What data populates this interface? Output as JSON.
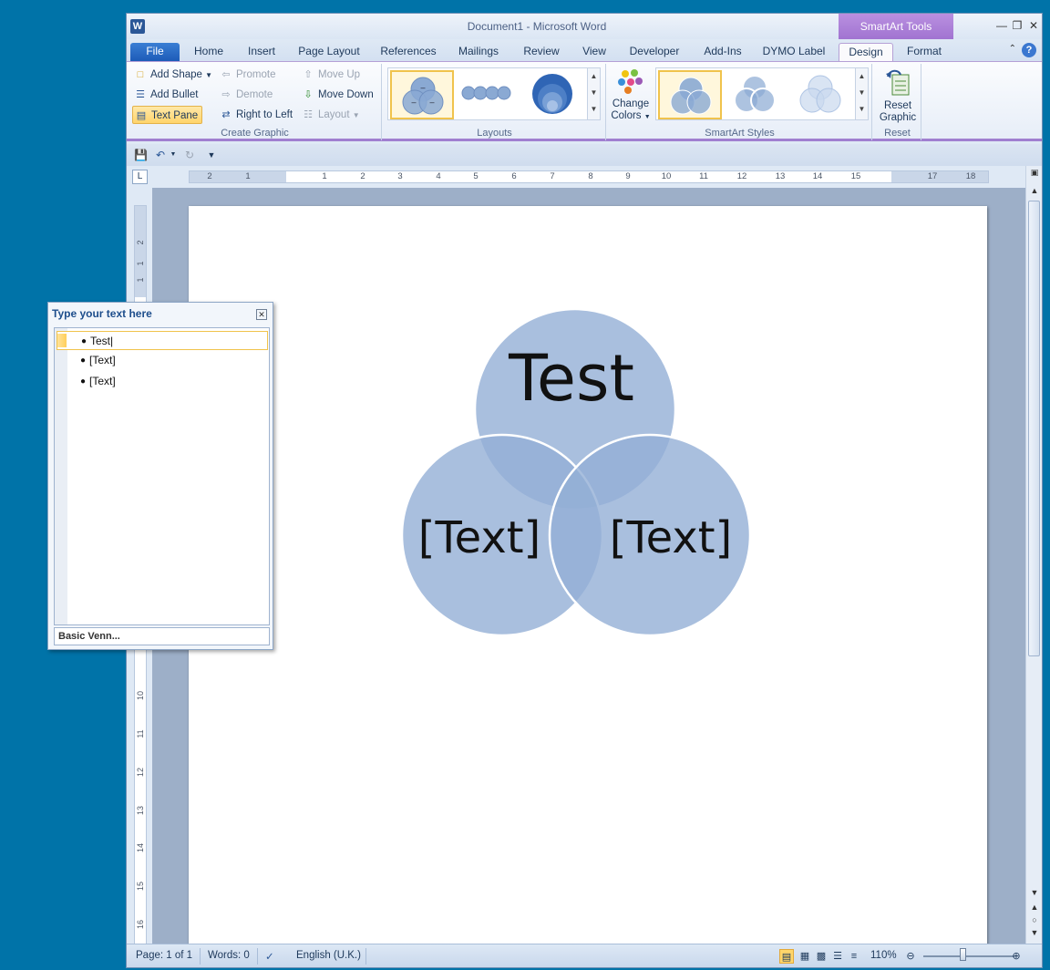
{
  "window": {
    "title": "Document1  -  Microsoft Word",
    "tools_tab": "SmartArt Tools",
    "app_icon_letter": "W"
  },
  "tabs": [
    "File",
    "Home",
    "Insert",
    "Page Layout",
    "References",
    "Mailings",
    "Review",
    "View",
    "Developer",
    "Add-Ins",
    "DYMO Label",
    "Design",
    "Format"
  ],
  "ribbon": {
    "create_graphic": {
      "label": "Create Graphic",
      "add_shape": "Add Shape",
      "add_bullet": "Add Bullet",
      "text_pane": "Text Pane",
      "promote": "Promote",
      "demote": "Demote",
      "right_to_left": "Right to Left",
      "move_up": "Move Up",
      "move_down": "Move Down",
      "layout": "Layout"
    },
    "layouts": {
      "label": "Layouts"
    },
    "smartart_styles": {
      "label": "SmartArt Styles",
      "change_colors_line1": "Change",
      "change_colors_line2": "Colors"
    },
    "reset": {
      "label": "Reset",
      "reset_graphic_line1": "Reset",
      "reset_graphic_line2": "Graphic"
    }
  },
  "ruler": {
    "h_ticks": [
      "2",
      "1",
      "1",
      "2",
      "3",
      "4",
      "5",
      "6",
      "7",
      "8",
      "9",
      "10",
      "11",
      "12",
      "13",
      "14",
      "15",
      "17",
      "18"
    ],
    "v_ticks": [
      "2",
      "1",
      "1",
      "10",
      "11",
      "12",
      "13",
      "14",
      "15",
      "16"
    ]
  },
  "venn": {
    "top_label": "Test",
    "left_label": "[Text]",
    "right_label": "[Text]",
    "fill_color": "#93afd6"
  },
  "text_pane": {
    "title": "Type your text here",
    "items": [
      "Test",
      "[Text]",
      "[Text]"
    ],
    "footer": "Basic Venn..."
  },
  "status": {
    "page": "Page: 1 of 1",
    "words": "Words: 0",
    "language": "English (U.K.)",
    "zoom": "110%"
  },
  "colors": {
    "desktop": "#0073a8",
    "file_tab": "#1d5bb8",
    "tools_tab": "#a174d1",
    "selection": "#f0c34c"
  }
}
